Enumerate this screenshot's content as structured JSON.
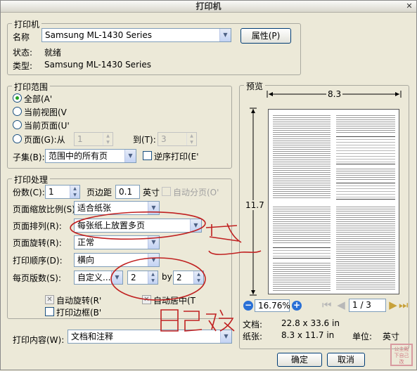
{
  "dialog": {
    "title": "打印机"
  },
  "printer": {
    "legend": "打印机",
    "name_label": "名称",
    "name_value": "Samsung ML-1430 Series",
    "properties_button": "属性(P)",
    "status_label": "状态:",
    "status_value": "就绪",
    "type_label": "类型:",
    "type_value": "Samsung ML-1430 Series"
  },
  "range": {
    "legend": "打印范围",
    "all": "全部(A'",
    "current_view": "当前视图(V",
    "current_page": "当前页面(U'",
    "pages": "页面(G):从",
    "from": "1",
    "to_label": "到(T):",
    "to": "3",
    "subset_label": "子集(B):",
    "subset_value": "范围中的所有页",
    "reverse": "逆序打印(E'"
  },
  "handling": {
    "legend": "打印处理",
    "copies_label": "份数(C):",
    "copies": "1",
    "margin_label": "页边距",
    "margin_value": "0.1",
    "margin_unit": "英寸",
    "collate": "自动分页(O'",
    "scaling_label": "页面缩放比例(S):",
    "scaling_value": "适合纸张",
    "arrangement_label": "页面排列(R):",
    "arrangement_value": "每张纸上放置多页",
    "rotation_label": "页面旋转(R):",
    "rotation_value": "正常",
    "order_label": "打印顺序(D):",
    "order_value": "横向",
    "pages_per_sheet_label": "每页版数(S):",
    "pages_per_sheet_value": "自定义...",
    "cols": "2",
    "by": "by",
    "rows": "2",
    "auto_rotate": "自动旋转(R'",
    "auto_center": "自动居中(T",
    "print_border": "打印边框(B'"
  },
  "content": {
    "label": "打印内容(W):",
    "value": "文档和注释"
  },
  "preview": {
    "legend": "预览",
    "width": "8.3",
    "height": "11.7",
    "zoom": "16.76%",
    "page": "1 / 3",
    "doc_label": "文档:",
    "doc_value": "22.8 x 33.6 in",
    "paper_label": "纸张:",
    "paper_value": "8.3 x 11.7 in",
    "unit_label": "单位:",
    "unit_value": "英寸"
  },
  "buttons": {
    "ok": "确定",
    "cancel": "取消"
  },
  "annotation": {
    "handwritten": "自己改"
  },
  "stamp": {
    "text": "公主殿下自己改"
  },
  "colors": {
    "ink": "#c02020",
    "accent_nav": "#c7a13a",
    "zoom_button": "#2a70d6"
  }
}
